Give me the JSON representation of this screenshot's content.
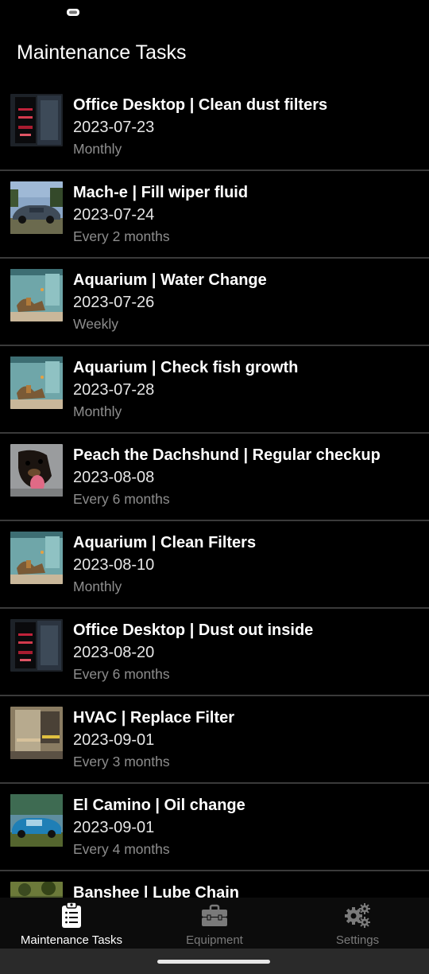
{
  "app": {
    "title": "Maintenance Tasks"
  },
  "tasks": [
    {
      "title": "Office Desktop | Clean dust filters",
      "date": "2023-07-23",
      "frequency": "Monthly",
      "thumb": "pc"
    },
    {
      "title": "Mach-e | Fill wiper fluid",
      "date": "2023-07-24",
      "frequency": "Every 2 months",
      "thumb": "car"
    },
    {
      "title": "Aquarium | Water Change",
      "date": "2023-07-26",
      "frequency": "Weekly",
      "thumb": "aquarium"
    },
    {
      "title": "Aquarium | Check fish growth",
      "date": "2023-07-28",
      "frequency": "Monthly",
      "thumb": "aquarium"
    },
    {
      "title": "Peach the Dachshund | Regular checkup",
      "date": "2023-08-08",
      "frequency": "Every 6 months",
      "thumb": "dog"
    },
    {
      "title": "Aquarium | Clean Filters",
      "date": "2023-08-10",
      "frequency": "Monthly",
      "thumb": "aquarium"
    },
    {
      "title": "Office Desktop | Dust out inside",
      "date": "2023-08-20",
      "frequency": "Every 6 months",
      "thumb": "pc"
    },
    {
      "title": "HVAC | Replace Filter",
      "date": "2023-09-01",
      "frequency": "Every 3 months",
      "thumb": "hvac"
    },
    {
      "title": "El Camino | Oil change",
      "date": "2023-09-01",
      "frequency": "Every 4 months",
      "thumb": "elcamino"
    },
    {
      "title": "Banshee | Lube Chain",
      "date": "",
      "frequency": "",
      "thumb": "banshee"
    }
  ],
  "nav": {
    "items": [
      {
        "label": "Maintenance Tasks",
        "icon": "clipboard-list-icon",
        "active": true
      },
      {
        "label": "Equipment",
        "icon": "toolbox-icon",
        "active": false
      },
      {
        "label": "Settings",
        "icon": "gears-icon",
        "active": false
      }
    ]
  },
  "colors": {
    "background": "#000000",
    "divider": "#3a3a3a",
    "secondary_text": "#8e8e8e",
    "inactive_nav": "#7a7a7a"
  }
}
